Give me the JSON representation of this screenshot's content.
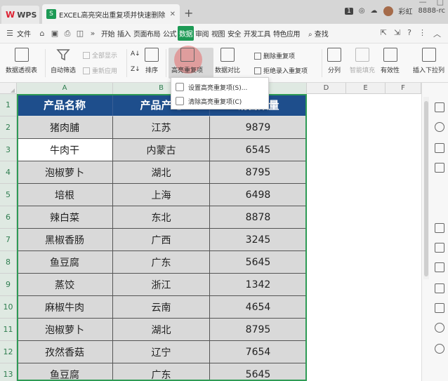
{
  "titlebar": {
    "wps_label": "WPS",
    "doc_title": "EXCEL高亮突出重复项并快速删除",
    "new_tab": "+",
    "page_badge": "1",
    "user_name": "彩虹",
    "account": "8888-rc"
  },
  "menubar": {
    "file": "文件",
    "items": [
      "开始",
      "插入",
      "页面布局",
      "公式",
      "数据",
      "审阅",
      "视图",
      "安全",
      "开发工具",
      "特色应用"
    ],
    "active": "数据",
    "search": "查找"
  },
  "ribbon": {
    "pivot": "数据透视表",
    "autofilter": "自动筛选",
    "show_all": "全部显示",
    "reapply": "重新应用",
    "sort": "排序",
    "highlight_dup": "高亮重复项",
    "compare": "数据对比",
    "remove_dup": "删除重复项",
    "reject_dup": "拒绝录入重复项",
    "split": "分列",
    "smart_fill": "智能填充",
    "validity": "有效性",
    "insert_dropdown": "插入下拉列"
  },
  "dropdown": {
    "set_highlight": "设置高亮重复项(S)...",
    "clear_highlight": "清除高亮重复项(C)"
  },
  "columns": [
    "A",
    "B",
    "C",
    "D",
    "E",
    "F"
  ],
  "table": {
    "headers": [
      "产品名称",
      "产品产地",
      "销售数量"
    ],
    "rows": [
      [
        "猪肉脯",
        "江苏",
        "9879"
      ],
      [
        "牛肉干",
        "内蒙古",
        "6545"
      ],
      [
        "泡椒萝卜",
        "湖北",
        "8795"
      ],
      [
        "培根",
        "上海",
        "6498"
      ],
      [
        "辣白菜",
        "东北",
        "8878"
      ],
      [
        "黑椒香肠",
        "广西",
        "3245"
      ],
      [
        "鱼豆腐",
        "广东",
        "5645"
      ],
      [
        "蒸饺",
        "浙江",
        "1342"
      ],
      [
        "麻椒牛肉",
        "云南",
        "4654"
      ],
      [
        "泡椒萝卜",
        "湖北",
        "8795"
      ],
      [
        "孜然香菇",
        "辽宁",
        "7654"
      ],
      [
        "鱼豆腐",
        "广东",
        "5645"
      ]
    ],
    "row_numbers": [
      "1",
      "2",
      "3",
      "4",
      "5",
      "6",
      "7",
      "8",
      "9",
      "10",
      "11",
      "12",
      "13"
    ]
  }
}
